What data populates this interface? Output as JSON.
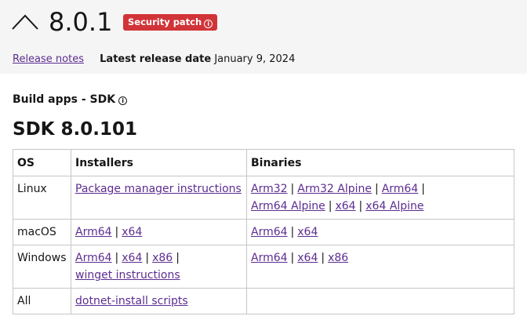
{
  "header": {
    "version": "8.0.1",
    "badge_label": "Security patch",
    "badge_icon": "info-icon",
    "collapse_icon": "chevron-up-icon",
    "colors": {
      "badge_bg": "#d13438",
      "link": "#5c2d91",
      "band": "#f5f5f5"
    }
  },
  "meta": {
    "release_notes_link": "Release notes",
    "latest_release_label": "Latest release date",
    "latest_release_date": "January 9, 2024"
  },
  "section": {
    "label": "Build apps - SDK",
    "info_icon": "info-icon",
    "sdk_title": "SDK 8.0.101"
  },
  "table": {
    "headers": [
      "OS",
      "Installers",
      "Binaries"
    ],
    "rows": [
      {
        "os": "Linux",
        "installers": [
          "Package manager instructions"
        ],
        "binaries": [
          "Arm32",
          "Arm32 Alpine",
          "Arm64",
          "Arm64 Alpine",
          "x64",
          "x64 Alpine"
        ]
      },
      {
        "os": "macOS",
        "installers": [
          "Arm64",
          "x64"
        ],
        "binaries": [
          "Arm64",
          "x64"
        ]
      },
      {
        "os": "Windows",
        "installers": [
          "Arm64",
          "x64",
          "x86",
          "winget instructions"
        ],
        "binaries": [
          "Arm64",
          "x64",
          "x86"
        ]
      },
      {
        "os": "All",
        "installers": [
          "dotnet-install scripts"
        ],
        "binaries": []
      }
    ],
    "separator": "|"
  }
}
